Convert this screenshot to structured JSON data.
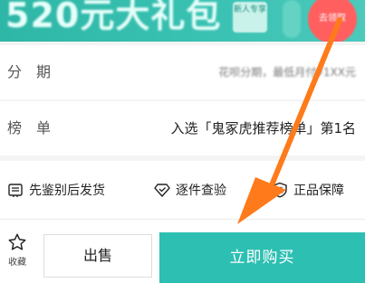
{
  "banner": {
    "headline": "520元大礼包",
    "badge": "新人专享",
    "tag": "去领取"
  },
  "installment": {
    "label": "分期",
    "value": "花呗分期，最低月付¥1XX元"
  },
  "ranking": {
    "label": "榜单",
    "value": "入选「鬼冢虎推荐榜单」第1名"
  },
  "services": [
    {
      "label": "先鉴别后发货",
      "icon": "certificate-icon"
    },
    {
      "label": "逐件查验",
      "icon": "diamond-check-icon"
    },
    {
      "label": "正品保障",
      "icon": "shield-icon"
    }
  ],
  "bottom_bar": {
    "favorite_label": "收藏",
    "sell_label": "出售",
    "buy_label": "立即购买"
  },
  "colors": {
    "accent": "#2dbfb2",
    "arrow": "#ff7a1a",
    "badge_red": "#ff5f5f"
  }
}
